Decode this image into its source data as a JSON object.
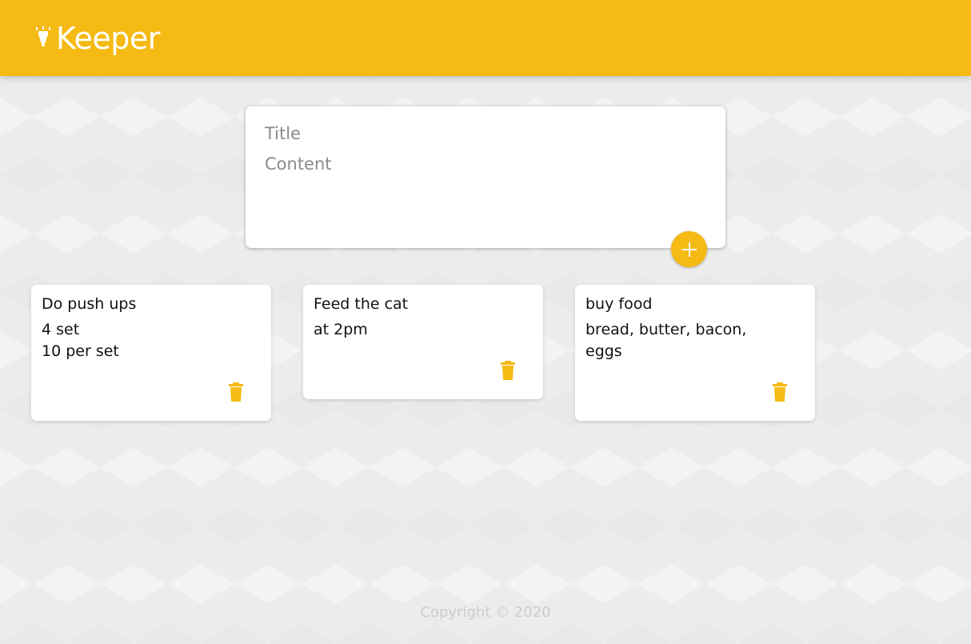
{
  "header": {
    "title": "Keeper",
    "logo_icon": "highlighter-icon"
  },
  "create": {
    "title_placeholder": "Title",
    "content_placeholder": "Content",
    "add_icon": "plus-icon"
  },
  "notes": [
    {
      "title": "Do push ups",
      "content": "4 set\n10 per set"
    },
    {
      "title": "Feed the cat",
      "content": "at 2pm"
    },
    {
      "title": "buy food",
      "content": "bread, butter, bacon,\neggs"
    }
  ],
  "footer": {
    "text": "Copyright © 2020"
  },
  "colors": {
    "accent": "#f5ba13",
    "background": "#ececec",
    "card": "#ffffff"
  }
}
